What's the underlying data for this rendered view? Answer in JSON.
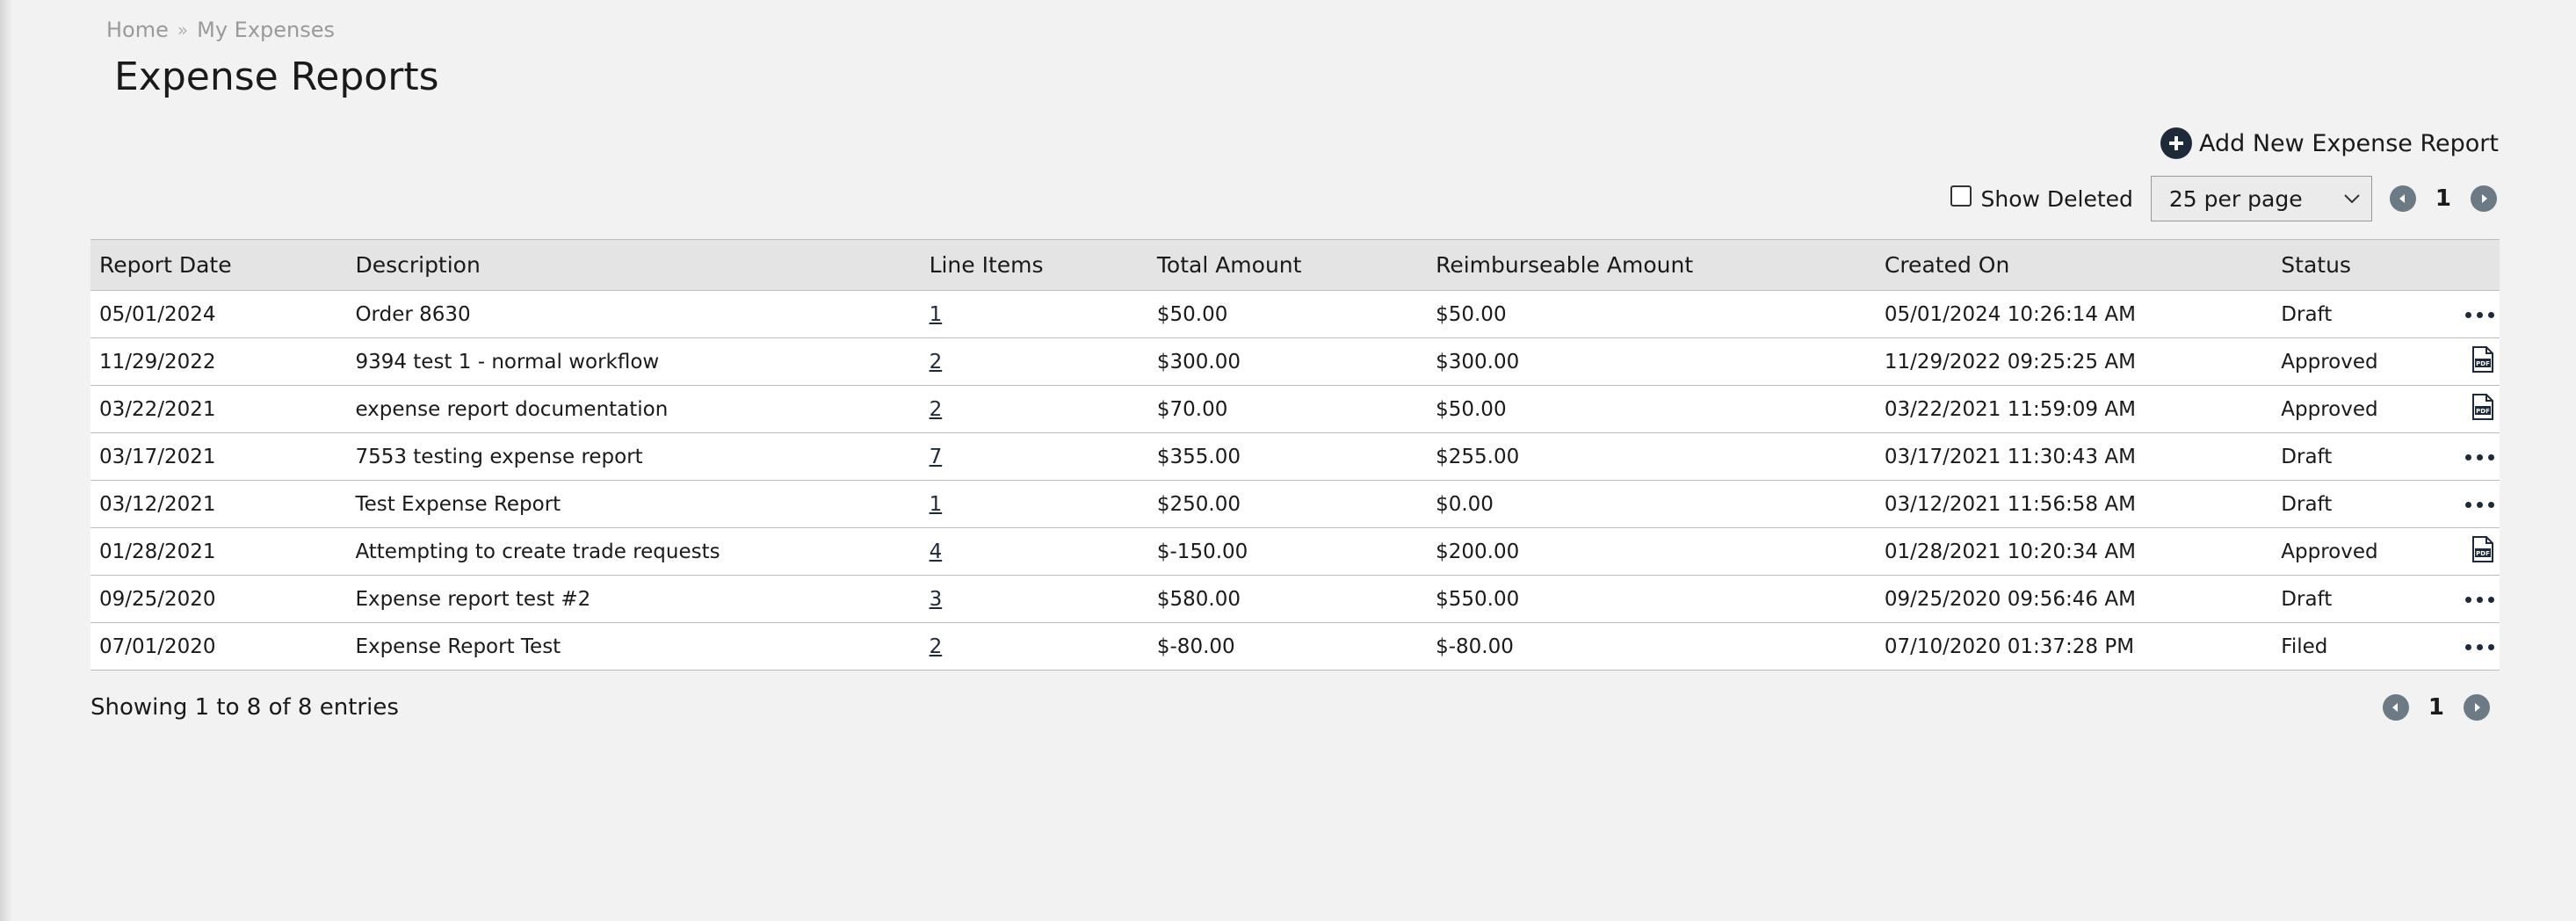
{
  "breadcrumb": {
    "home": "Home",
    "separator": "»",
    "current": "My Expenses"
  },
  "page": {
    "title": "Expense Reports"
  },
  "actions": {
    "add_new_label": "Add New Expense Report"
  },
  "filters": {
    "show_deleted_label": "Show Deleted",
    "show_deleted_checked": false,
    "per_page_value": "25 per page"
  },
  "pagination": {
    "current_page": "1"
  },
  "table": {
    "headers": {
      "report_date": "Report Date",
      "description": "Description",
      "line_items": "Line Items",
      "total_amount": "Total Amount",
      "reimburseable_amount": "Reimburseable Amount",
      "created_on": "Created On",
      "status": "Status"
    },
    "rows": [
      {
        "report_date": "05/01/2024",
        "description": "Order 8630",
        "line_items": "1",
        "total_amount": "$50.00",
        "reimburseable_amount": "$50.00",
        "created_on": "05/01/2024 10:26:14 AM",
        "status": "Draft",
        "action_icon": "more-icon"
      },
      {
        "report_date": "11/29/2022",
        "description": "9394 test 1 - normal workflow",
        "line_items": "2",
        "total_amount": "$300.00",
        "reimburseable_amount": "$300.00",
        "created_on": "11/29/2022 09:25:25 AM",
        "status": "Approved",
        "action_icon": "pdf-icon"
      },
      {
        "report_date": "03/22/2021",
        "description": "expense report documentation",
        "line_items": "2",
        "total_amount": "$70.00",
        "reimburseable_amount": "$50.00",
        "created_on": "03/22/2021 11:59:09 AM",
        "status": "Approved",
        "action_icon": "pdf-icon"
      },
      {
        "report_date": "03/17/2021",
        "description": "7553 testing expense report",
        "line_items": "7",
        "total_amount": "$355.00",
        "reimburseable_amount": "$255.00",
        "created_on": "03/17/2021 11:30:43 AM",
        "status": "Draft",
        "action_icon": "more-icon"
      },
      {
        "report_date": "03/12/2021",
        "description": "Test Expense Report",
        "line_items": "1",
        "total_amount": "$250.00",
        "reimburseable_amount": "$0.00",
        "created_on": "03/12/2021 11:56:58 AM",
        "status": "Draft",
        "action_icon": "more-icon"
      },
      {
        "report_date": "01/28/2021",
        "description": "Attempting to create trade requests",
        "line_items": "4",
        "total_amount": "$-150.00",
        "reimburseable_amount": "$200.00",
        "created_on": "01/28/2021 10:20:34 AM",
        "status": "Approved",
        "action_icon": "pdf-icon"
      },
      {
        "report_date": "09/25/2020",
        "description": "Expense report test #2",
        "line_items": "3",
        "total_amount": "$580.00",
        "reimburseable_amount": "$550.00",
        "created_on": "09/25/2020 09:56:46 AM",
        "status": "Draft",
        "action_icon": "more-icon"
      },
      {
        "report_date": "07/01/2020",
        "description": "Expense Report Test",
        "line_items": "2",
        "total_amount": "$-80.00",
        "reimburseable_amount": "$-80.00",
        "created_on": "07/10/2020 01:37:28 PM",
        "status": "Filed",
        "action_icon": "more-icon"
      }
    ]
  },
  "footer": {
    "showing_text": "Showing 1 to 8 of 8 entries"
  },
  "colors": {
    "accent": "#1e2a3a",
    "pager_button": "#6b7a85",
    "background": "#f2f2f2",
    "header_row": "#e4e4e4"
  }
}
